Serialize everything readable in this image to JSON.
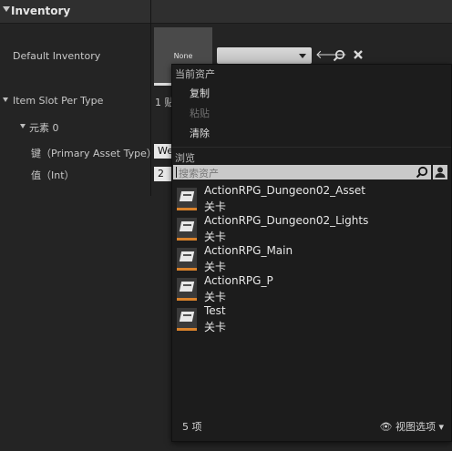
{
  "section": {
    "title": "Inventory"
  },
  "properties": {
    "default_inventory": {
      "label": "Default Inventory",
      "thumbnail_text": "None"
    },
    "item_slot_per_type": {
      "label": "Item Slot Per Type",
      "value_text": "1 贴"
    },
    "element": {
      "label": "元素 0"
    },
    "key": {
      "label": "键（Primary Asset Type）",
      "value": "We"
    },
    "value": {
      "label": "值（Int）",
      "value": "2"
    }
  },
  "toolbar_icons": [
    "arrow-left-icon",
    "search-icon",
    "clear-icon"
  ],
  "menu": {
    "current_asset_header": "当前资产",
    "copy": "复制",
    "paste": "粘贴",
    "clear": "清除",
    "browse_header": "浏览",
    "search_placeholder": "搜索资产",
    "assets": [
      {
        "name": "ActionRPG_Dungeon02_Asset",
        "type": "关卡"
      },
      {
        "name": "ActionRPG_Dungeon02_Lights",
        "type": "关卡"
      },
      {
        "name": "ActionRPG_Main",
        "type": "关卡"
      },
      {
        "name": "ActionRPG_P",
        "type": "关卡"
      },
      {
        "name": "Test",
        "type": "关卡"
      }
    ],
    "item_count": "5 项",
    "view_options": "视图选项"
  },
  "colors": {
    "background": "#242424",
    "menu_bg": "#1c1c1c",
    "accent": "#d9822b"
  }
}
